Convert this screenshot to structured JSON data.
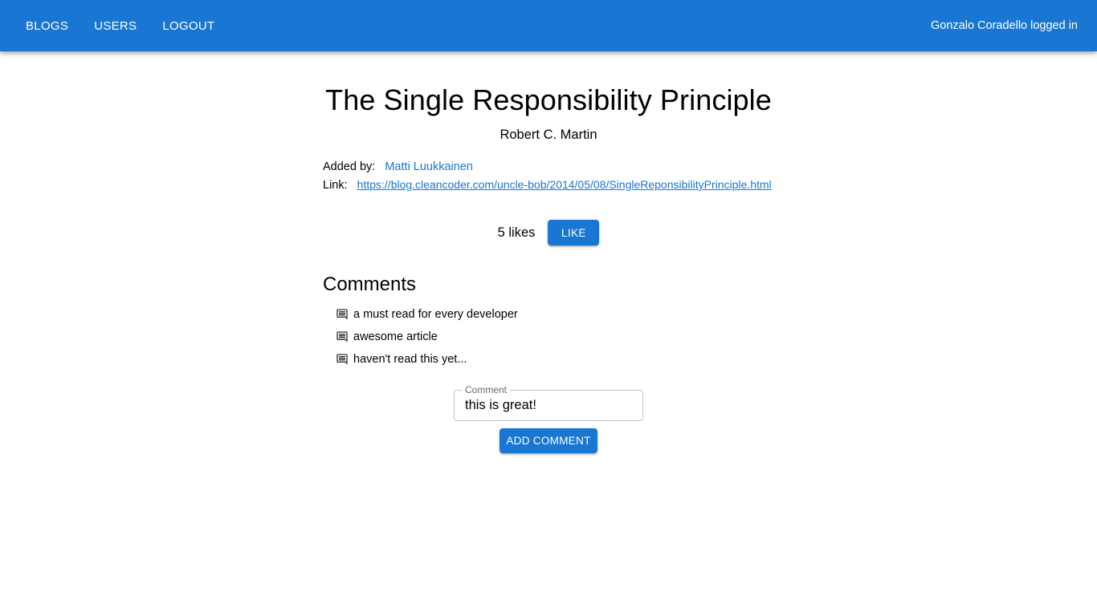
{
  "nav": {
    "items": [
      "BLOGS",
      "USERS",
      "LOGOUT"
    ],
    "logged_in": "Gonzalo Coradello logged in"
  },
  "blog": {
    "title": "The Single Responsibility Principle",
    "author": "Robert C. Martin",
    "added_by_label": "Added by:",
    "added_by": "Matti Luukkainen",
    "link_label": "Link:",
    "url": "https://blog.cleancoder.com/uncle-bob/2014/05/08/SingleReponsibilityPrinciple.html",
    "likes": "5 likes",
    "like_button": "LIKE"
  },
  "comments": {
    "heading": "Comments",
    "items": [
      "a must read for every developer",
      "awesome article",
      "haven't read this yet..."
    ],
    "field_label": "Comment",
    "field_value": "this is great!",
    "add_button": "ADD COMMENT"
  },
  "colors": {
    "primary": "#1976d2"
  }
}
